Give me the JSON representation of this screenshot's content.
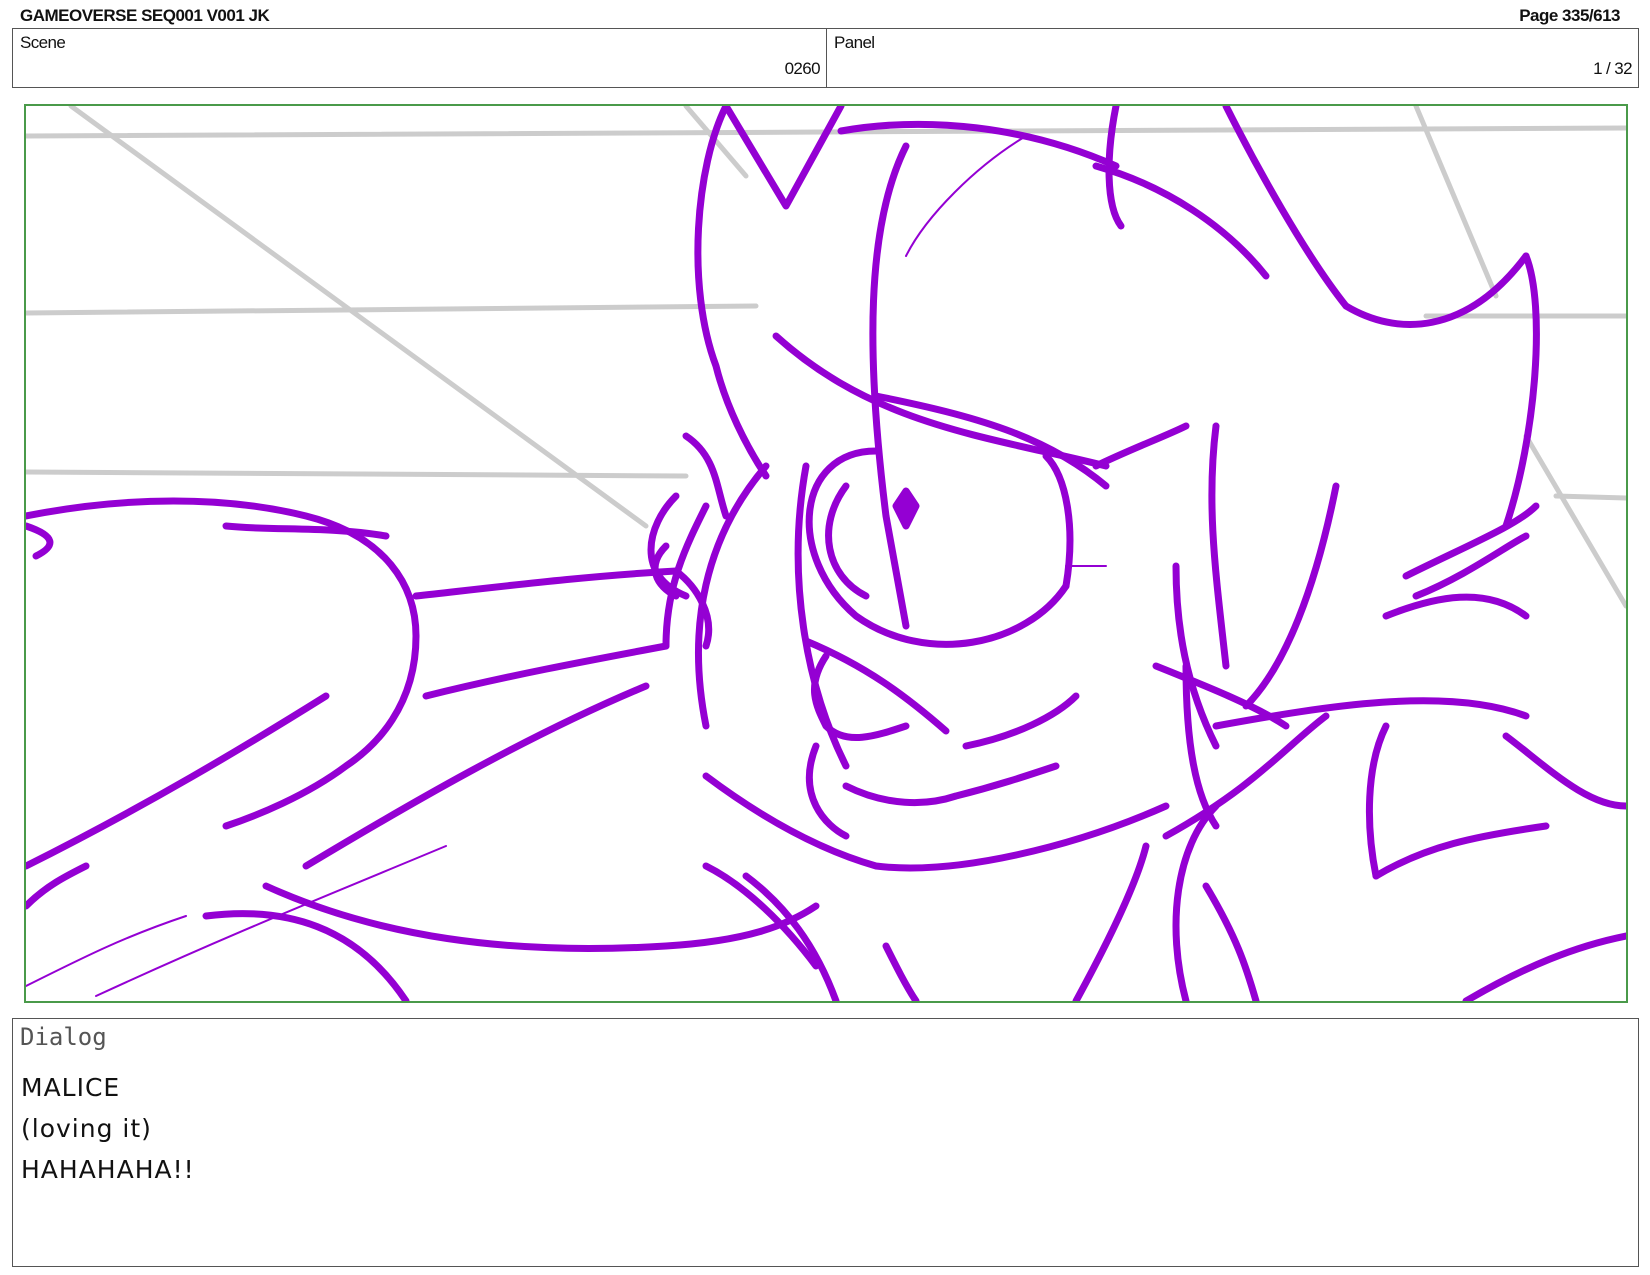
{
  "header": {
    "title": "GAMEOVERSE SEQ001 V001 JK",
    "page": "Page 335/613"
  },
  "info": {
    "scene_label": "Scene",
    "scene_value": "0260",
    "panel_label": "Panel",
    "panel_value": "1 / 32"
  },
  "frame": {
    "border_color": "#4a9a4a",
    "sketch_color": "#9400d3",
    "guide_color": "#cccccc"
  },
  "dialog": {
    "label": "Dialog",
    "lines": [
      "MALICE",
      "(loving it)",
      "HAHAHAHA!!"
    ]
  }
}
